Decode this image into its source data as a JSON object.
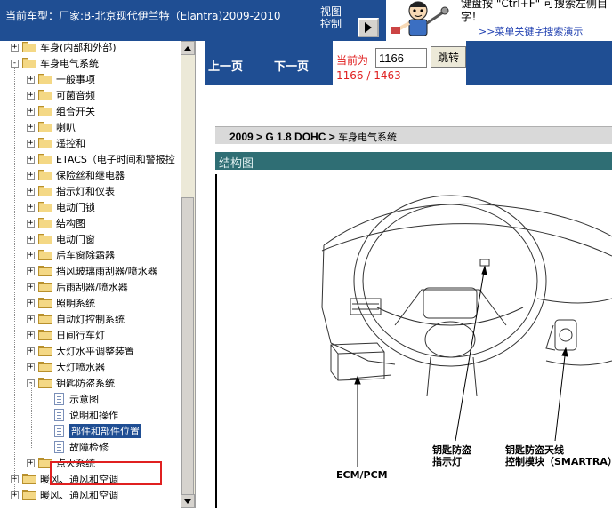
{
  "header": {
    "car_title": "当前车型：厂家:B-北京现代伊兰特（Elantra)2009-2010",
    "view_control_line1": "视图",
    "view_control_line2": "控制",
    "hint_line1": "键盘按 \"Ctrl+F\"  可搜索左侧目",
    "hint_line2": "字！",
    "hint_link": ">>菜单关键字搜索演示"
  },
  "tree": {
    "items": [
      {
        "label": "车身(内部和外部)",
        "expander": "+",
        "type": "folder"
      },
      {
        "label": "车身电气系统",
        "expander": "-",
        "type": "folder"
      },
      {
        "label": "一般事项",
        "expander": "+",
        "type": "folder"
      },
      {
        "label": "可菌音频",
        "expander": "+",
        "type": "folder"
      },
      {
        "label": "组合开关",
        "expander": "+",
        "type": "folder"
      },
      {
        "label": "喇叭",
        "expander": "+",
        "type": "folder"
      },
      {
        "label": "遥控和",
        "expander": "+",
        "type": "folder"
      },
      {
        "label": "ETACS（电子时间和警报控",
        "expander": "+",
        "type": "folder"
      },
      {
        "label": "保险丝和继电器",
        "expander": "+",
        "type": "folder"
      },
      {
        "label": "指示灯和仪表",
        "expander": "+",
        "type": "folder"
      },
      {
        "label": "电动门锁",
        "expander": "+",
        "type": "folder"
      },
      {
        "label": "结构图",
        "expander": "+",
        "type": "folder"
      },
      {
        "label": "电动门窗",
        "expander": "+",
        "type": "folder"
      },
      {
        "label": "后车窗除霜器",
        "expander": "+",
        "type": "folder"
      },
      {
        "label": "挡风玻璃雨刮器/喷水器",
        "expander": "+",
        "type": "folder"
      },
      {
        "label": "后雨刮器/喷水器",
        "expander": "+",
        "type": "folder"
      },
      {
        "label": "照明系统",
        "expander": "+",
        "type": "folder"
      },
      {
        "label": "自动灯控制系统",
        "expander": "+",
        "type": "folder"
      },
      {
        "label": "日间行车灯",
        "expander": "+",
        "type": "folder"
      },
      {
        "label": "大灯水平调整装置",
        "expander": "+",
        "type": "folder"
      },
      {
        "label": "大灯喷水器",
        "expander": "+",
        "type": "folder"
      },
      {
        "label": "钥匙防盗系统",
        "expander": "-",
        "type": "folder"
      },
      {
        "label": "示意图",
        "expander": "",
        "type": "doc"
      },
      {
        "label": "说明和操作",
        "expander": "",
        "type": "doc"
      },
      {
        "label": "部件和部件位置",
        "expander": "",
        "type": "doc",
        "selected": true
      },
      {
        "label": "故障检修",
        "expander": "",
        "type": "doc"
      },
      {
        "label": "点火系统",
        "expander": "+",
        "type": "folder"
      },
      {
        "label": "暖风、通风和空调",
        "expander": "+",
        "type": "folder"
      },
      {
        "label": "暖风、通风和空调",
        "expander": "+",
        "type": "folder"
      }
    ]
  },
  "nav": {
    "prev_label": "上一页",
    "next_label": "下一页",
    "current_label": "当前为",
    "page_value": "1166",
    "jump_label": "跳转",
    "page_count": "1166 / 1463"
  },
  "content": {
    "crumb_bold": "2009 > G 1.8 DOHC > ",
    "crumb_normal": "车身电气系统",
    "section_title": "结构图",
    "callouts": {
      "ecm": "ECM/PCM",
      "indicator_line1": "钥匙防盗",
      "indicator_line2": "指示灯",
      "antenna_line1": "钥匙防盗天线",
      "antenna_line2": "控制模块（SMARTRA）"
    }
  },
  "colors": {
    "header_blue": "#1f4e93",
    "selection_blue": "#1f4e93",
    "highlight_red": "#e02020",
    "section_teal": "#2f6e74"
  }
}
